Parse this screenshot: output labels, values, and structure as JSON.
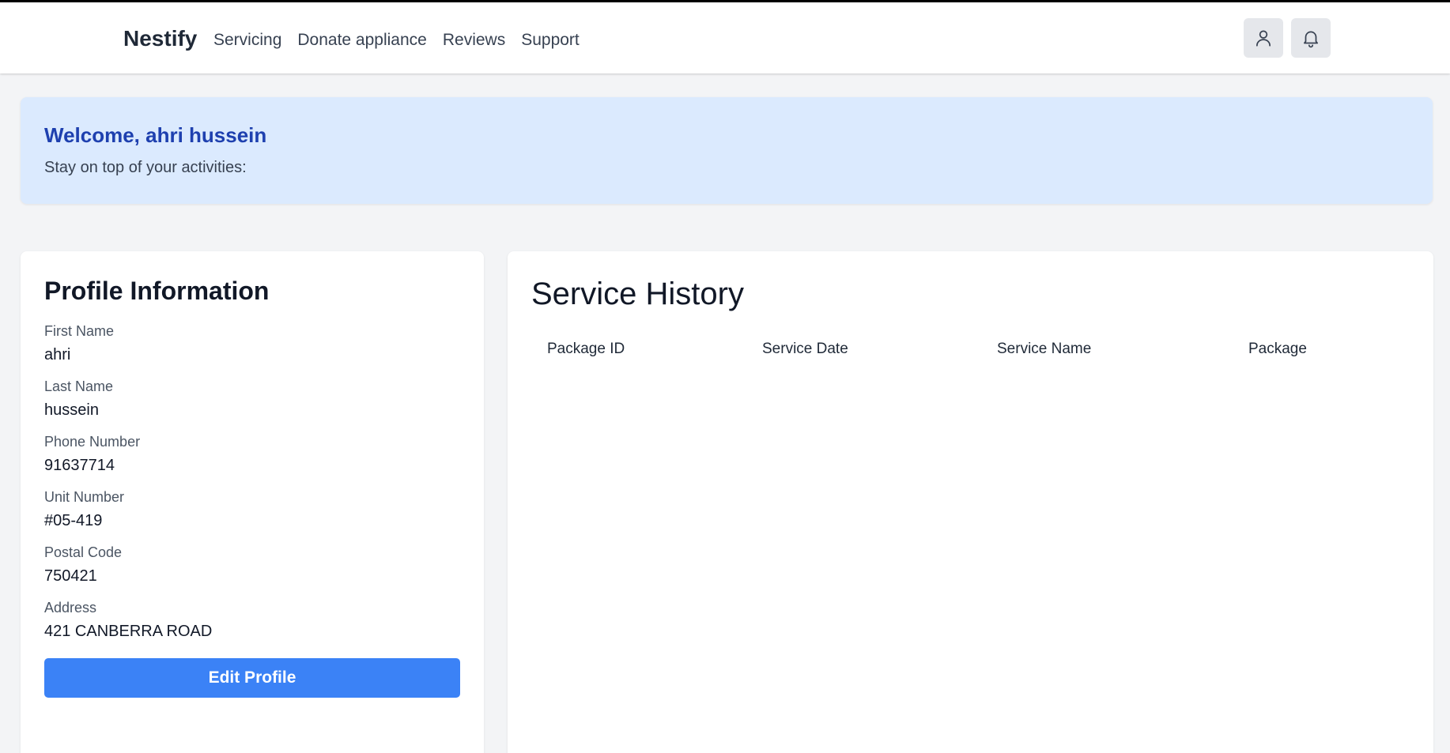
{
  "brand": "Nestify",
  "nav": {
    "links": [
      "Servicing",
      "Donate appliance",
      "Reviews",
      "Support"
    ]
  },
  "header_icons": {
    "user": "user-icon",
    "bell": "bell-icon"
  },
  "welcome": {
    "title": "Welcome, ahri hussein",
    "subtitle": "Stay on top of your activities:"
  },
  "profile": {
    "title": "Profile Information",
    "fields": [
      {
        "label": "First Name",
        "value": "ahri"
      },
      {
        "label": "Last Name",
        "value": "hussein"
      },
      {
        "label": "Phone Number",
        "value": "91637714"
      },
      {
        "label": "Unit Number",
        "value": "#05-419"
      },
      {
        "label": "Postal Code",
        "value": "750421"
      },
      {
        "label": "Address",
        "value": "421 CANBERRA ROAD"
      }
    ],
    "edit_label": "Edit Profile"
  },
  "history": {
    "title": "Service History",
    "columns": [
      "Package ID",
      "Service Date",
      "Service Name",
      "Package"
    ]
  },
  "colors": {
    "accent": "#3b82f6",
    "welcome_bg": "#dbeafe",
    "welcome_title": "#1e40af",
    "page_bg": "#f3f4f6"
  }
}
